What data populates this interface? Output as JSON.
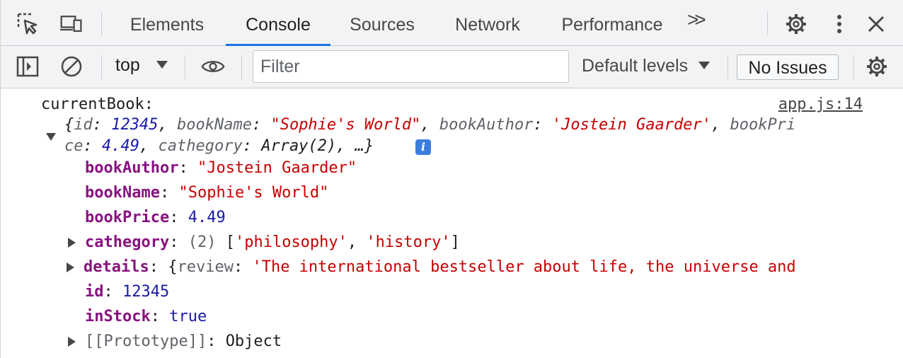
{
  "tabs": [
    {
      "label": "Elements"
    },
    {
      "label": "Console"
    },
    {
      "label": "Sources"
    },
    {
      "label": "Network"
    },
    {
      "label": "Performance"
    }
  ],
  "active_tab": "Console",
  "more_tabs_label": ">>",
  "toolbar": {
    "context": "top",
    "filter_placeholder": "Filter",
    "levels": "Default levels",
    "issues": "No Issues"
  },
  "console": {
    "source_link": "app.js:14",
    "label": "currentBook:",
    "summary_line1": {
      "open": "{",
      "id_key": "id",
      "id_val": "12345",
      "bookName_key": "bookName",
      "bookName_val": "\"Sophie's World\"",
      "bookAuthor_key": "bookAuthor",
      "bookAuthor_val": "'Jostein Gaarder'",
      "bookPrice_key_part1": "bookPri"
    },
    "summary_line2": {
      "bookPrice_key_part2": "ce",
      "bookPrice_val": "4.49",
      "cathegory_key": "cathegory",
      "cathegory_val": "Array(2)",
      "ellipsis": "…}"
    },
    "info_badge": "i",
    "props": {
      "bookAuthor_key": "bookAuthor",
      "bookAuthor_val": "\"Jostein Gaarder\"",
      "bookName_key": "bookName",
      "bookName_val": "\"Sophie's World\"",
      "bookPrice_key": "bookPrice",
      "bookPrice_val": "4.49",
      "cathegory_key": "cathegory",
      "cathegory_count": "(2)",
      "cathegory_item1": "'philosophy'",
      "cathegory_item2": "'history'",
      "details_key": "details",
      "details_review_key": "review",
      "details_review_val": "'The international bestseller about life, the universe and",
      "id_key": "id",
      "id_val": "12345",
      "inStock_key": "inStock",
      "inStock_val": "true",
      "prototype_key": "[[Prototype]]",
      "prototype_val": "Object"
    }
  },
  "colors": {
    "accent": "#1a73e8",
    "string": "#c80000",
    "number": "#1a1aa6",
    "property": "#881280"
  }
}
